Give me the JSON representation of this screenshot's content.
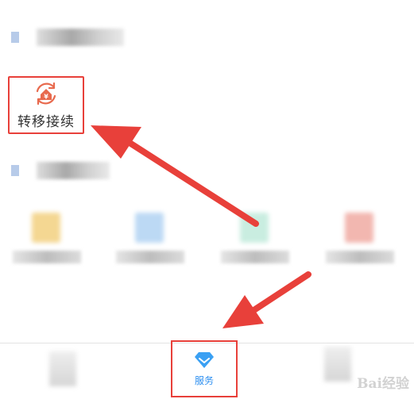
{
  "services": {
    "transfer": {
      "label": "转移接续",
      "icon": "transfer-yen-icon",
      "color": "#e86a4e"
    }
  },
  "bottom_nav": {
    "services": {
      "label": "服务",
      "icon": "diamond-icon",
      "color": "#2d8ff0"
    }
  },
  "watermark": {
    "text": "Bai经验"
  },
  "colors": {
    "annotation": "#e8403a",
    "accent": "#2d8ff0"
  }
}
